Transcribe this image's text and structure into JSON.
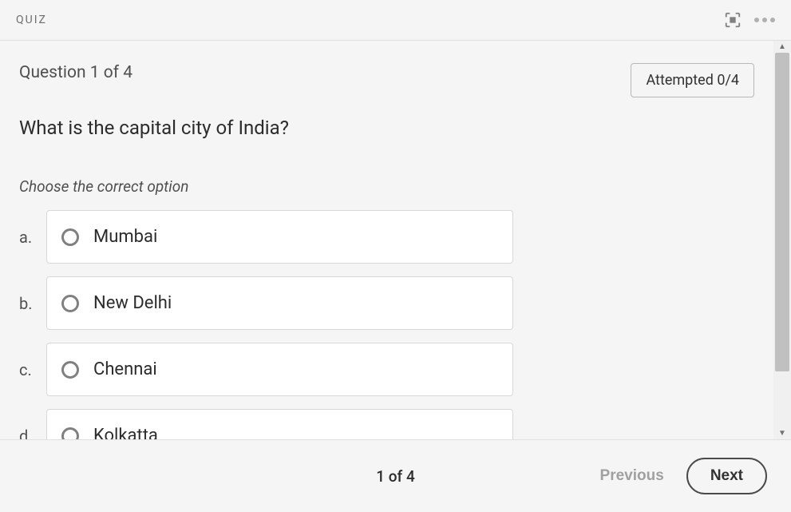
{
  "header": {
    "title": "QUIZ"
  },
  "question": {
    "counter": "Question 1 of 4",
    "attempted": "Attempted 0/4",
    "text": "What is the capital city of India?",
    "instruction": "Choose the correct option",
    "options": [
      {
        "letter": "a.",
        "text": "Mumbai"
      },
      {
        "letter": "b.",
        "text": "New Delhi"
      },
      {
        "letter": "c.",
        "text": "Chennai"
      },
      {
        "letter": "d.",
        "text": "Kolkatta"
      }
    ]
  },
  "footer": {
    "page": "1 of 4",
    "previous": "Previous",
    "next": "Next"
  }
}
